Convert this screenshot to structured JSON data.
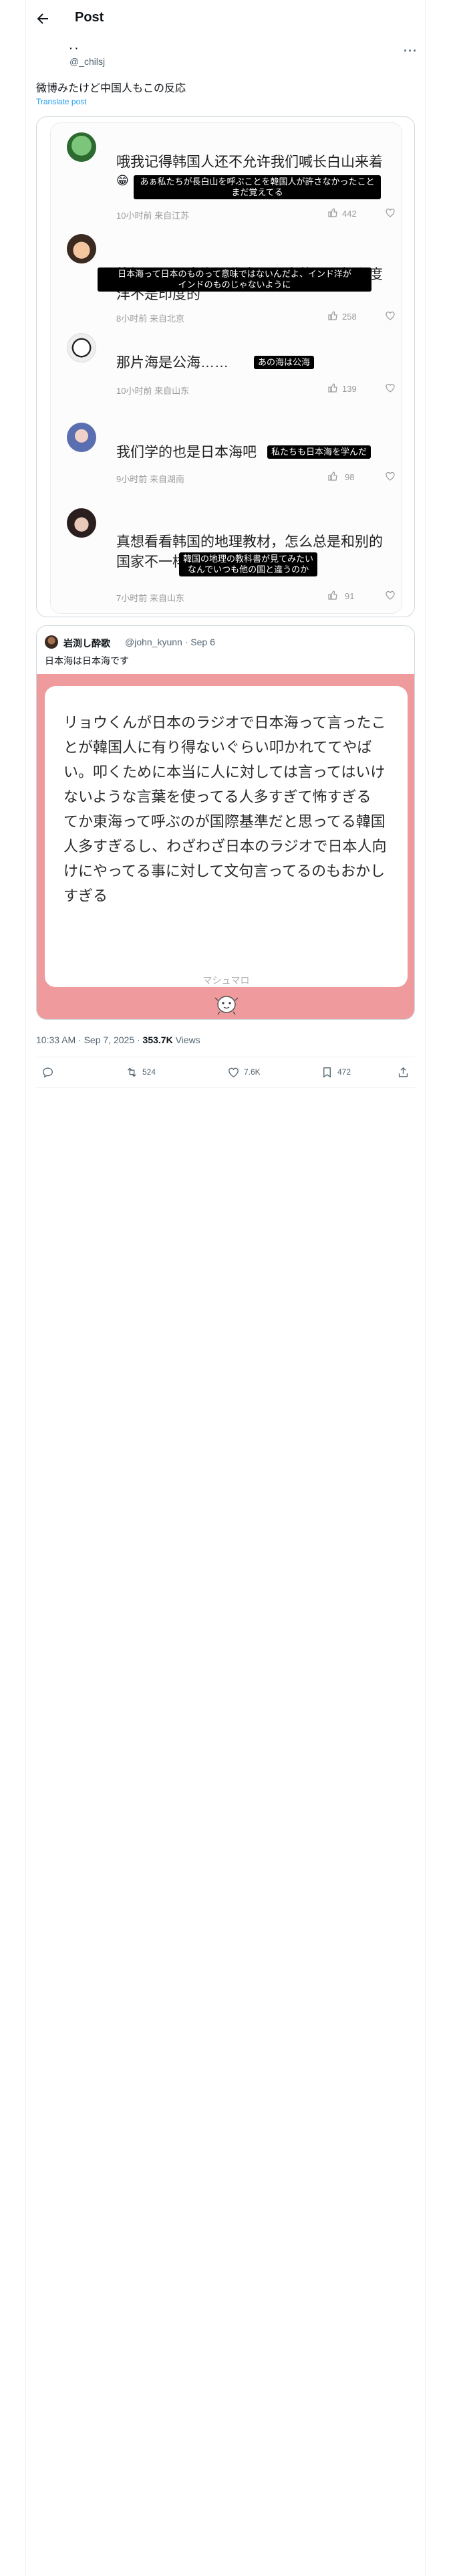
{
  "header": {
    "title": "Post"
  },
  "author": {
    "name": "· ·",
    "handle": "@_chilsj"
  },
  "post": {
    "text": "微博みたけど中国人もこの反応",
    "translate_label": "Translate post"
  },
  "comments": [
    {
      "text": "哦我记得韩国人还不允许我们喊长白山来着",
      "emoji": "😁",
      "subtitle": "あぁ私たちが長白山を呼ぶことを韓国人が許さなかったこと\nまだ覚えてる",
      "meta": "10小时前 来自江苏",
      "likes": "442"
    },
    {
      "text": "热知识，日本海不代表是日本的，正如印度洋不是印度的",
      "subtitle": "日本海って日本のものって意味ではないんだよ、インド洋が\nインドのものじゃないように",
      "meta": "8小时前 来自北京",
      "likes": "258"
    },
    {
      "text": "那片海是公海……",
      "subtitle": "あの海は公海",
      "meta": "10小时前 来自山东",
      "likes": "139"
    },
    {
      "text": "我们学的也是日本海吧",
      "subtitle": "私たちも日本海を学んだ",
      "meta": "9小时前 来自湖南",
      "likes": "98"
    },
    {
      "text": "真想看看韩国的地理教材，怎么总是和别的国家不一样",
      "subtitle": "韓国の地理の教科書が見てみたい\nなんでいつも他の国と違うのか",
      "meta": "7小时前 来自山东",
      "likes": "91"
    }
  ],
  "quote": {
    "name": "岩渕し酔歌",
    "handle": "@john_kyunn · Sep 6",
    "text": "日本海は日本海です",
    "note_text": "リョウくんが日本のラジオで日本海って言ったことが韓国人に有り得ないぐらい叩かれててやばい。叩くために本当に人に対しては言ってはいけないような言葉を使ってる人多すぎて怖すぎる\nてか東海って呼ぶのが国際基準だと思ってる韓国人多すぎるし、わざわざ日本のラジオで日本人向けにやってる事に対して文句言ってるのもおかしすぎる",
    "signature": "マシュマロ"
  },
  "stats": {
    "time": "10:33 AM · Sep 7, 2025 · ",
    "views_count": "353.7K",
    "views_label": " Views"
  },
  "actions": {
    "retweets": "524",
    "likes": "7.6K",
    "bookmarks": "472"
  },
  "colors": {
    "accent": "#1d9bf0",
    "media_bg": "#ef9a9c",
    "subtitle_bg": "#000000"
  }
}
